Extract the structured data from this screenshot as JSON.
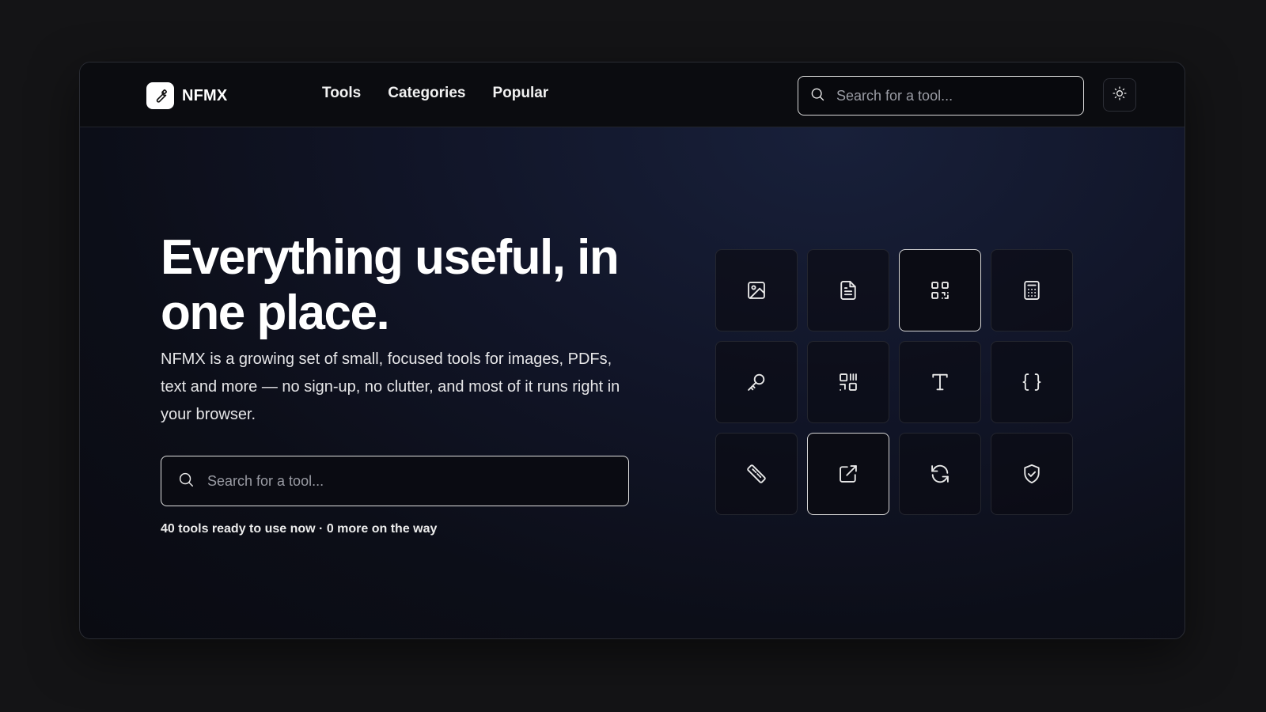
{
  "brand": {
    "name": "NFMX",
    "logo_icon": "wrench-icon"
  },
  "nav": {
    "links": [
      {
        "label": "Tools"
      },
      {
        "label": "Categories"
      },
      {
        "label": "Popular"
      }
    ],
    "search_placeholder": "Search for a tool...",
    "theme_toggle_icon": "sun-icon"
  },
  "hero": {
    "title": "Everything useful, in one place.",
    "description": "NFMX is a growing set of small, focused tools for images, PDFs, text and more — no sign-up, no clutter, and most of it runs right in your browser.",
    "search_placeholder": "Search for a tool...",
    "note": "40 tools ready to use now · 0 more on the way"
  },
  "tiles": [
    {
      "icon": "image-icon",
      "active": false
    },
    {
      "icon": "document-icon",
      "active": false
    },
    {
      "icon": "qr-code-icon",
      "active": true
    },
    {
      "icon": "calculator-icon",
      "active": false
    },
    {
      "icon": "key-icon",
      "active": false
    },
    {
      "icon": "barcode-grid-icon",
      "active": false
    },
    {
      "icon": "text-type-icon",
      "active": false
    },
    {
      "icon": "code-braces-icon",
      "active": false
    },
    {
      "icon": "ruler-icon",
      "active": false
    },
    {
      "icon": "external-link-icon",
      "active": true
    },
    {
      "icon": "refresh-icon",
      "active": false
    },
    {
      "icon": "shield-check-icon",
      "active": false
    }
  ],
  "colors": {
    "page_bg": "#141416",
    "navbar_bg": "#0b0c10",
    "hero_bg": "#111528",
    "text": "#ffffff",
    "border": "#24262f"
  }
}
